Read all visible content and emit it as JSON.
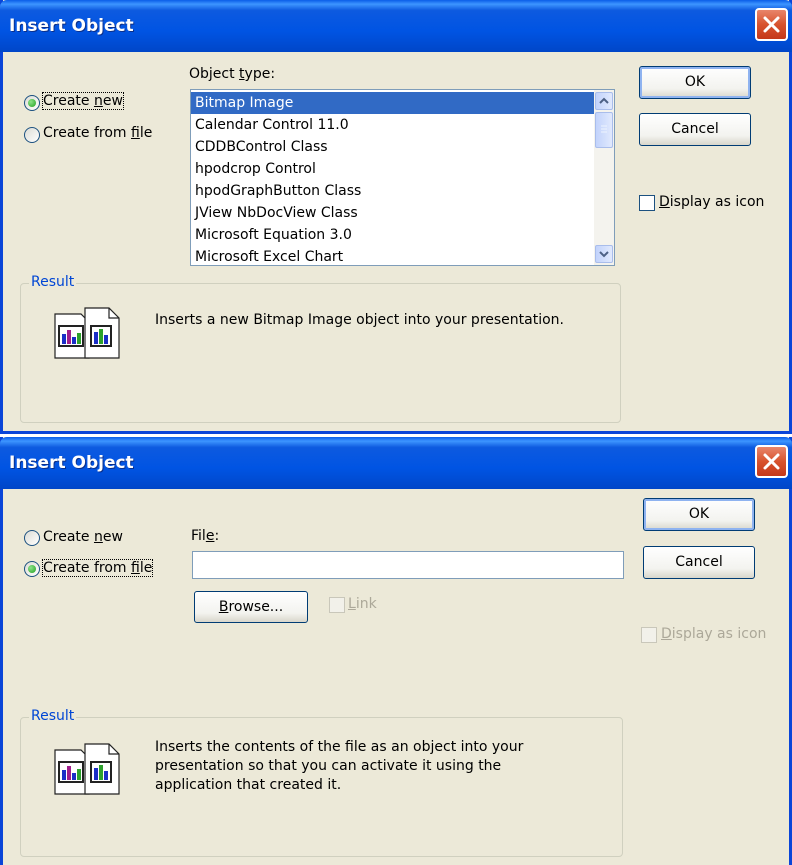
{
  "colors": {
    "titlebar": "#0054e3",
    "selection": "#316ac5",
    "close": "#d8532e",
    "group_label": "#0046d5"
  },
  "dialog1": {
    "title": "Insert Object",
    "radio_create_new": {
      "pre": "Create ",
      "key": "n",
      "post": "ew",
      "selected": true
    },
    "radio_create_from_file": {
      "pre": "Create from ",
      "key": "f",
      "post": "ile",
      "selected": false
    },
    "object_type_label": {
      "pre": "Object ",
      "key": "t",
      "post": "ype:"
    },
    "object_types": [
      "Bitmap Image",
      "Calendar Control 11.0",
      "CDDBControl Class",
      "hpodcrop Control",
      "hpodGraphButton Class",
      "JView NbDocView Class",
      "Microsoft Equation 3.0",
      "Microsoft Excel Chart"
    ],
    "selected_object": "Bitmap Image",
    "ok_label": "OK",
    "cancel_label": "Cancel",
    "display_as_icon": {
      "key": "D",
      "post": "isplay as icon",
      "checked": false
    },
    "result_label": "Result",
    "result_text": "Inserts a new Bitmap Image object into your presentation.",
    "result_icon": "chart-document-icon"
  },
  "dialog2": {
    "title": "Insert Object",
    "radio_create_new": {
      "pre": "Create ",
      "key": "n",
      "post": "ew",
      "selected": false
    },
    "radio_create_from_file": {
      "pre": "Create from ",
      "key": "f",
      "post": "ile",
      "selected": true
    },
    "file_label": {
      "pre": "Fil",
      "key": "e",
      "post": ":"
    },
    "file_value": "",
    "browse_button": {
      "key": "B",
      "post": "rowse..."
    },
    "link_checkbox": {
      "key": "L",
      "post": "ink",
      "checked": false,
      "enabled": false
    },
    "ok_label": "OK",
    "cancel_label": "Cancel",
    "display_as_icon": {
      "key": "D",
      "post": "isplay as icon",
      "checked": false,
      "enabled": false
    },
    "result_label": "Result",
    "result_lines": [
      "Inserts the contents of the file as an object into your",
      "presentation so that you can activate it using the",
      "application that created it."
    ],
    "result_icon": "chart-document-icon"
  }
}
